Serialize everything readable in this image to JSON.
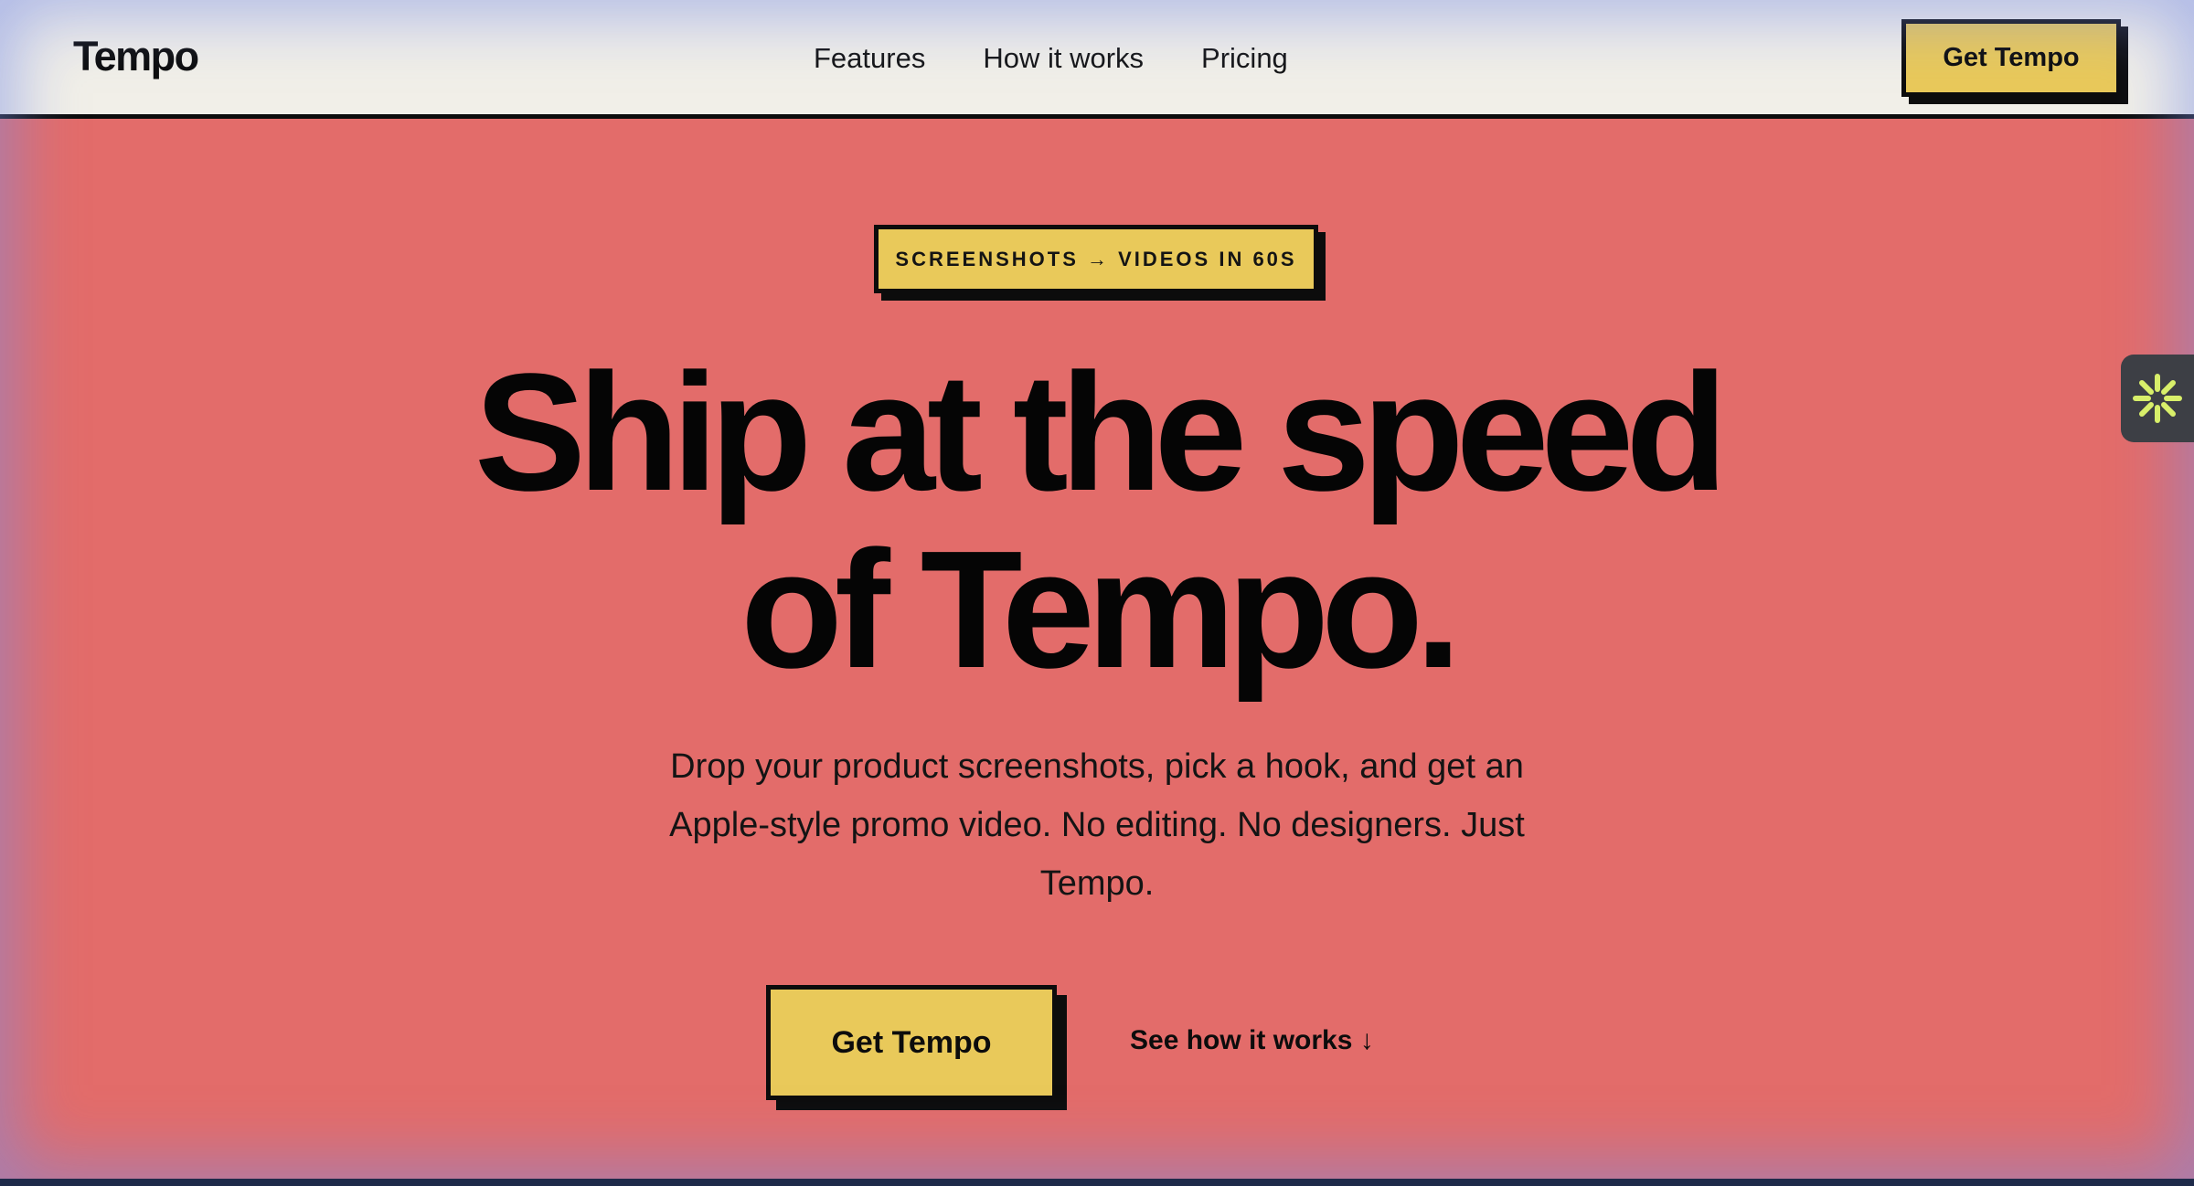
{
  "nav": {
    "brand": "Tempo",
    "links": [
      {
        "label": "Features"
      },
      {
        "label": "How it works"
      },
      {
        "label": "Pricing"
      }
    ],
    "cta_label": "Get Tempo"
  },
  "hero": {
    "badge": "SCREENSHOTS → VIDEOS IN 60S",
    "title_line_1": "Ship at the speed",
    "title_line_2": "of Tempo.",
    "subtitle": "Drop your product screenshots, pick a hook, and get an Apple-style promo video. No editing. No designers. Just Tempo.",
    "primary_cta": "Get Tempo",
    "secondary_cta": "See how it works ↓"
  },
  "side_widget": {
    "icon": "asterisk-sparkle-icon"
  },
  "colors": {
    "hero_background": "#e36c6a",
    "nav_background": "#f1efe8",
    "accent_yellow": "#e9c95a",
    "ink": "#0c0c0c",
    "widget_background": "#3d3f45",
    "widget_icon": "#d8ef6a"
  }
}
